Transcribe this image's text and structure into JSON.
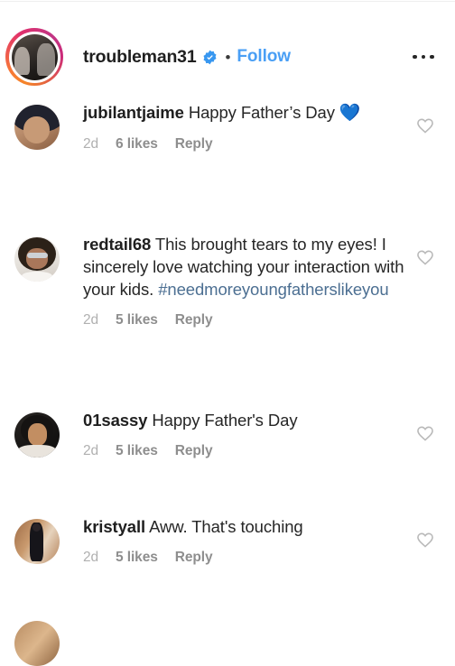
{
  "header": {
    "username": "troubleman31",
    "verified": true,
    "verified_icon": "verified-badge-icon",
    "separator": "•",
    "follow_label": "Follow",
    "more_icon": "more-options-icon",
    "avatar_name": "group-photo-avatar",
    "has_story_ring": true
  },
  "colors": {
    "link_blue": "#4a9ff5",
    "hashtag_blue": "#4c6f92",
    "text_primary": "#262626",
    "meta_gray": "#8e8e8e",
    "time_gray": "#b0b0b0",
    "divider": "#efefef",
    "story_ring_pink": "#c13584",
    "story_ring_orange": "#f58529"
  },
  "comments": [
    {
      "username": "jubilantjaime",
      "text": " Happy Father’s Day ",
      "emoji": "💙",
      "hashtag": "",
      "time": "2d",
      "likes": "6 likes",
      "reply": "Reply",
      "like_icon": "heart-outline-icon",
      "avatar_name": "commenter-avatar-jubilantjaime"
    },
    {
      "username": "redtail68",
      "text": " This brought tears to my eyes! I sincerely love watching your interaction with your kids. ",
      "emoji": "",
      "hashtag": "#needmoreyoungfatherslikeyou",
      "time": "2d",
      "likes": "5 likes",
      "reply": "Reply",
      "like_icon": "heart-outline-icon",
      "avatar_name": "commenter-avatar-redtail68"
    },
    {
      "username": "01sassy",
      "text": " Happy Father's Day",
      "emoji": "",
      "hashtag": "",
      "time": "2d",
      "likes": "5 likes",
      "reply": "Reply",
      "like_icon": "heart-outline-icon",
      "avatar_name": "commenter-avatar-01sassy"
    },
    {
      "username": "kristyall",
      "text": " Aww. That's touching",
      "emoji": "",
      "hashtag": "",
      "time": "2d",
      "likes": "5 likes",
      "reply": "Reply",
      "like_icon": "heart-outline-icon",
      "avatar_name": "commenter-avatar-kristyall"
    }
  ]
}
